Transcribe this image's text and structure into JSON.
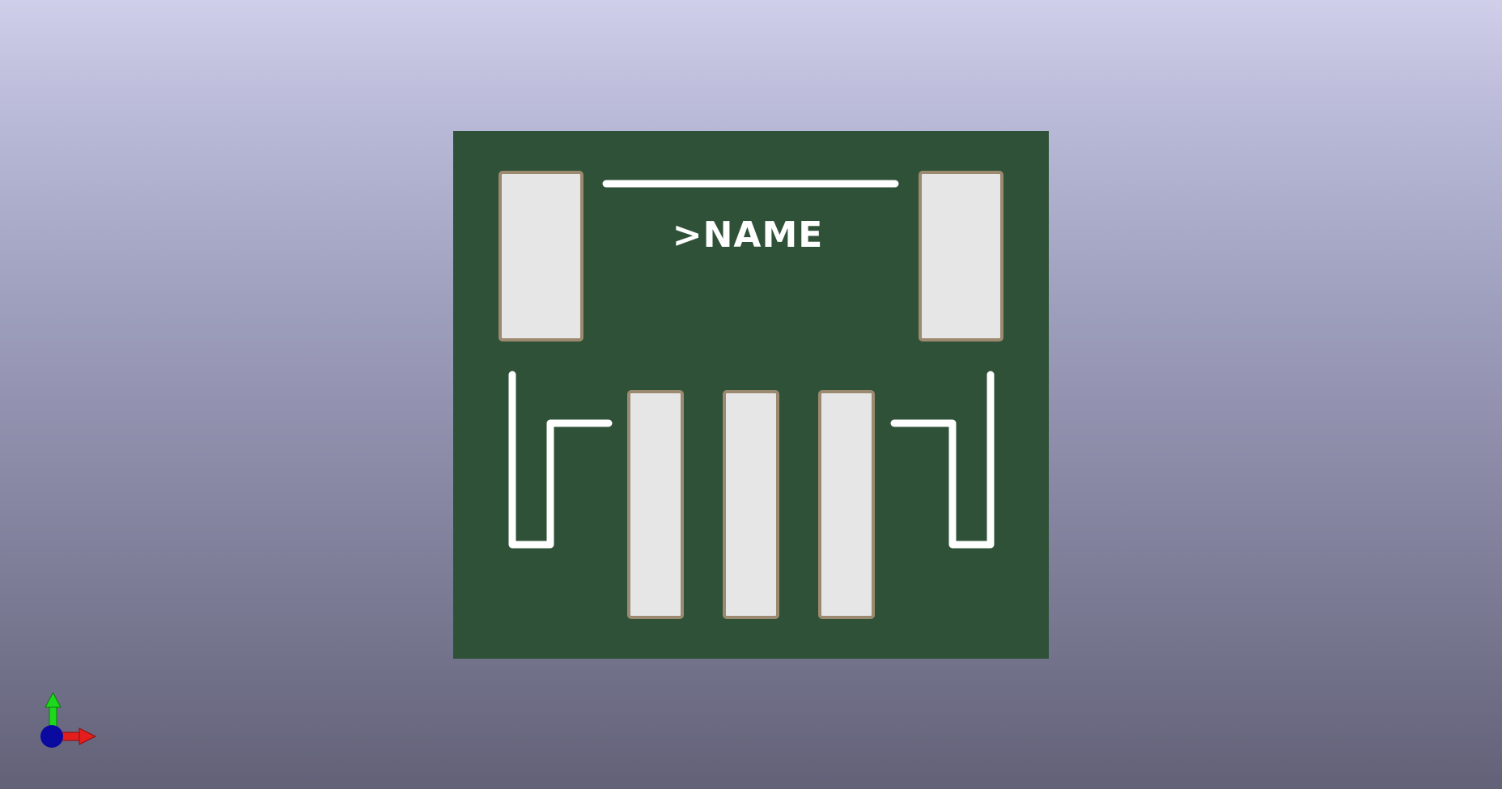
{
  "viewer": {
    "silkscreen_label": ">NAME"
  },
  "board": {
    "pcb_color": "#2f5138",
    "pad_fill": "#e6e6e6",
    "pad_outline": "#9c8a70",
    "silkscreen_color": "#ffffff"
  },
  "axis_gizmo": {
    "x_color": "#e41d1d",
    "y_color": "#1dd81d",
    "z_color": "#0a0aa0",
    "icon": "xyz-axis-icon"
  }
}
